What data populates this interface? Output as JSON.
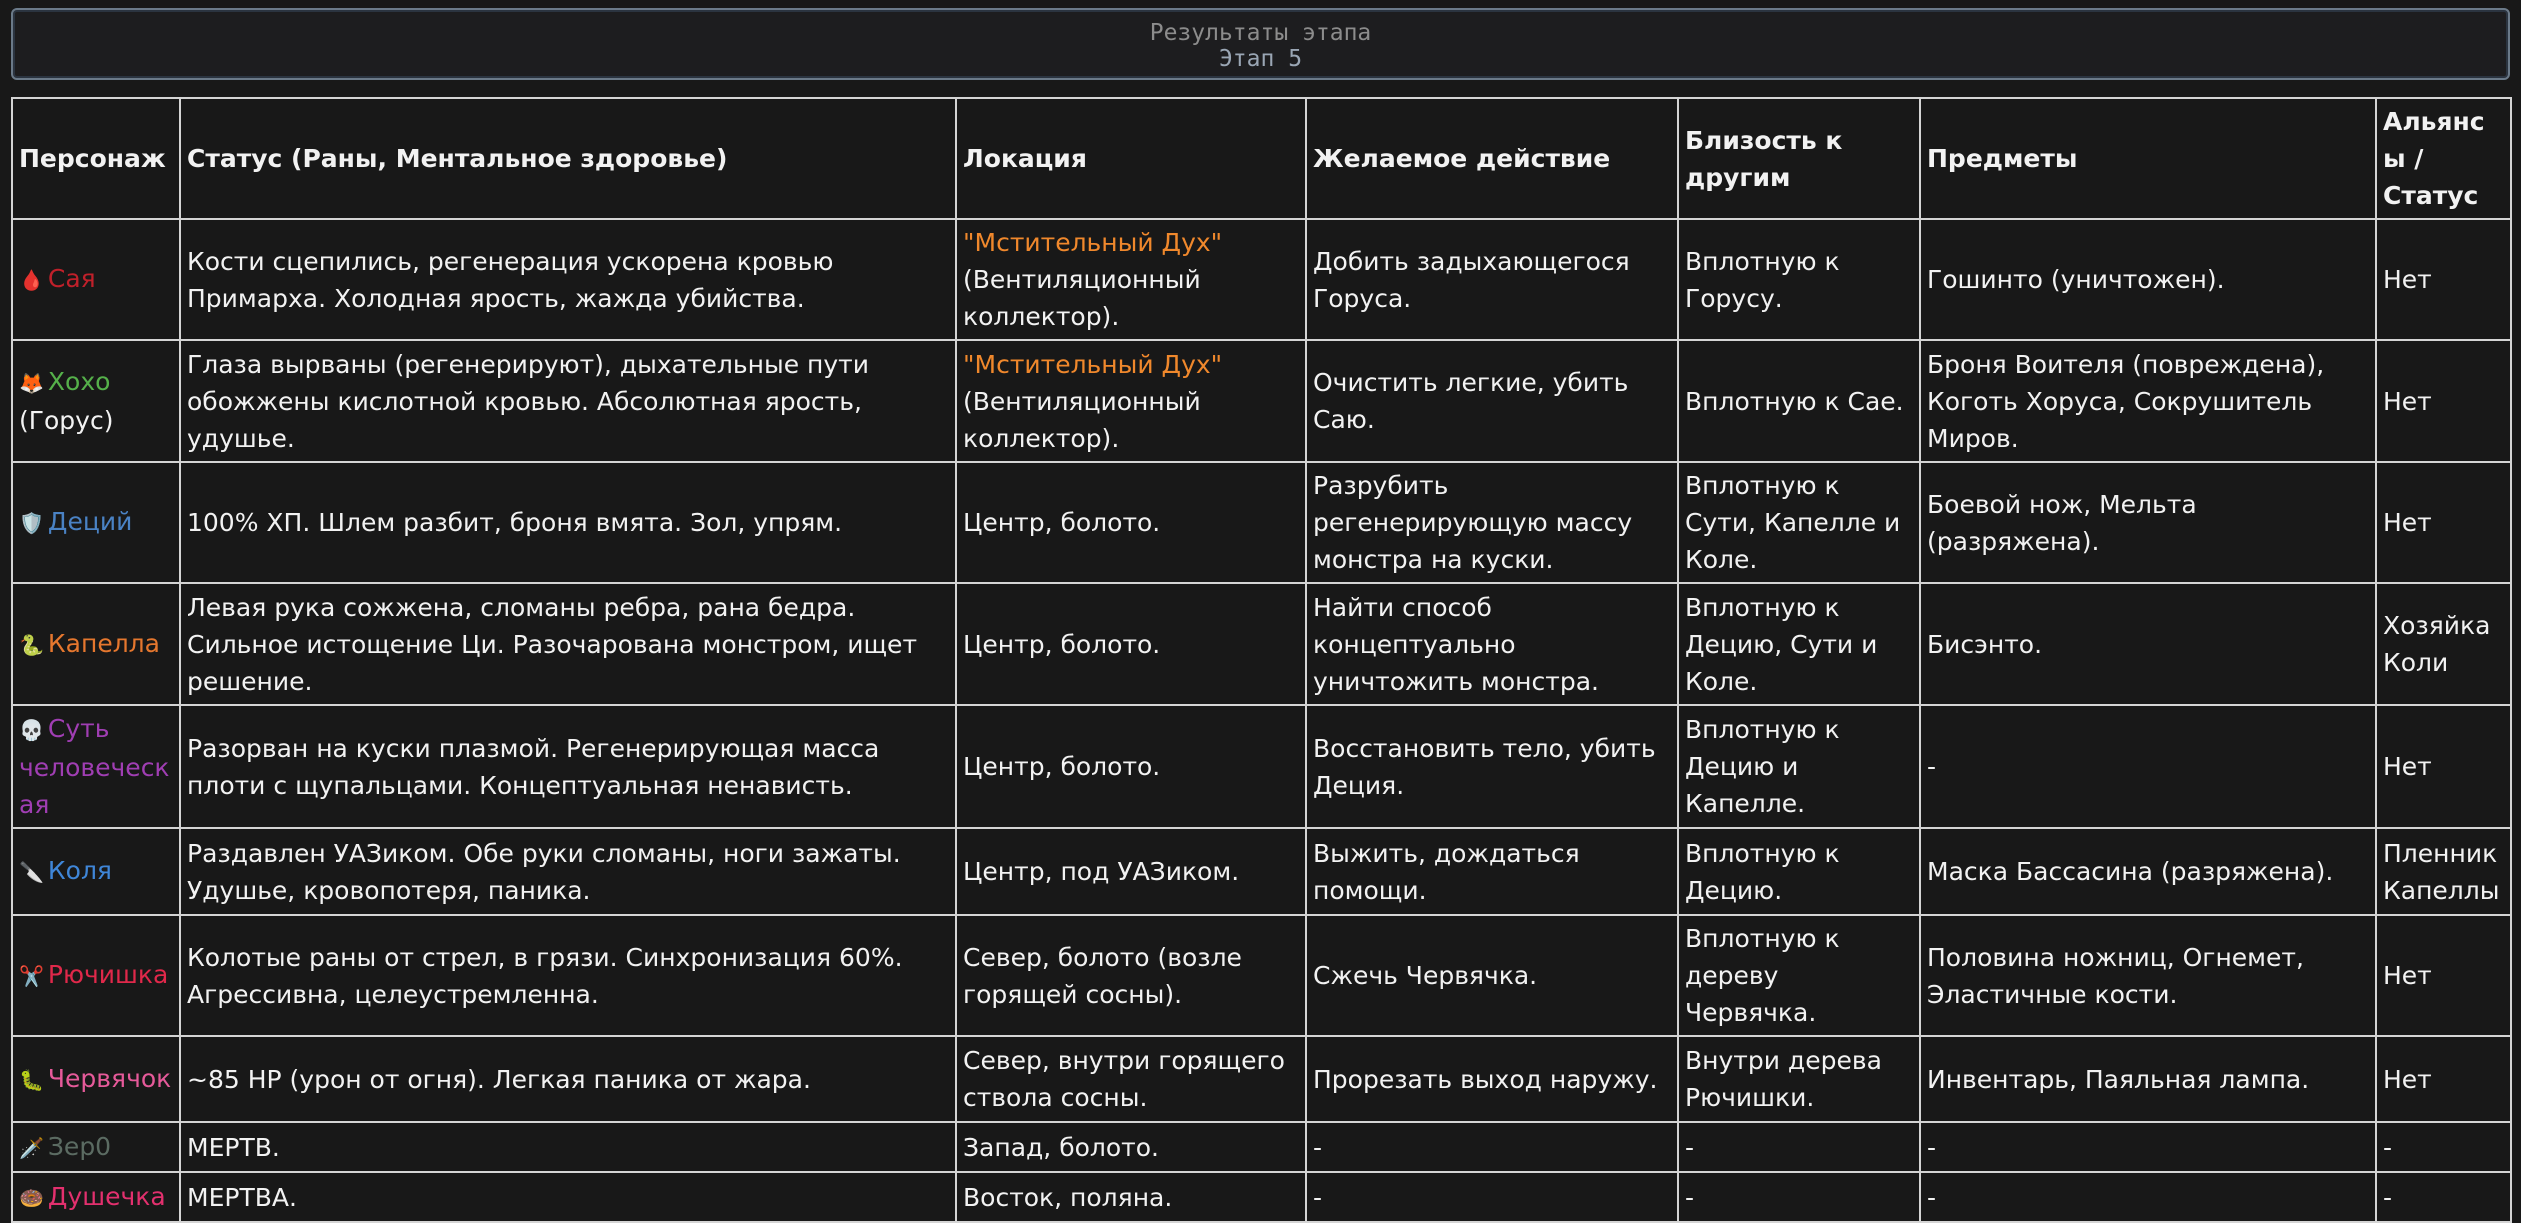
{
  "header": {
    "title": "Результаты этапа",
    "subtitle": "Этап 5"
  },
  "columns": [
    "Персонаж",
    "Статус (Раны, Ментальное здоровье)",
    "Локация",
    "Желаемое действие",
    "Близость к другим",
    "Предметы",
    "Альянсы / Статус"
  ],
  "rows": [
    {
      "icon": "🩸",
      "icon_name": "blood-drop-icon",
      "name": "Сая",
      "name_suffix": "",
      "color": "#c0202a",
      "status": "Кости сцепились, регенерация ускорена кровью Примарха. Холодная ярость, жажда убийства.",
      "location_accent": "\"Мстительный Дух\"",
      "location": "(Вентиляционный коллектор).",
      "action": "Добить задыхающегося Горуса.",
      "proximity": "Вплотную к Горусу.",
      "items": "Гошинто (уничтожен).",
      "alliance": "Нет"
    },
    {
      "icon": "🦊",
      "icon_name": "fox-icon",
      "name": "Хохо",
      "name_suffix": "(Горус)",
      "color": "#55b04a",
      "status": "Глаза вырваны (регенерируют), дыхательные пути обожжены кислотной кровью. Абсолютная ярость, удушье.",
      "location_accent": "\"Мстительный Дух\"",
      "location": "(Вентиляционный коллектор).",
      "action": "Очистить легкие, убить Саю.",
      "proximity": "Вплотную к Сае.",
      "items": "Броня Воителя (повреждена), Коготь Хоруса, Сокрушитель Миров.",
      "alliance": "Нет"
    },
    {
      "icon": "🛡️",
      "icon_name": "shield-icon",
      "name": "Деций",
      "name_suffix": "",
      "color": "#4a82c4",
      "status": "100% ХП. Шлем разбит, броня вмята. Зол, упрям.",
      "location_accent": "",
      "location": "Центр, болото.",
      "action": "Разрубить регенерирующую массу монстра на куски.",
      "proximity": "Вплотную к Сути, Капелле и Коле.",
      "items": "Боевой нож, Мельта (разряжена).",
      "alliance": "Нет"
    },
    {
      "icon": "🐍",
      "icon_name": "snake-icon",
      "name": "Капелла",
      "name_suffix": "",
      "color": "#e5772e",
      "status": "Левая рука сожжена, сломаны ребра, рана бедра. Сильное истощение Ци. Разочарована монстром, ищет решение.",
      "location_accent": "",
      "location": "Центр, болото.",
      "action": "Найти способ концептуально уничтожить монстра.",
      "proximity": "Вплотную к Децию, Сути и Коле.",
      "items": "Бисэнто.",
      "alliance": "Хозяйка Коли"
    },
    {
      "icon": "💀",
      "icon_name": "skull-icon",
      "name": "Суть человеческая",
      "name_suffix": "",
      "color": "#a03eb3",
      "status": "Разорван на куски плазмой. Регенерирующая масса плоти с щупальцами. Концептуальная ненависть.",
      "location_accent": "",
      "location": "Центр, болото.",
      "action": "Восстановить тело, убить Деция.",
      "proximity": "Вплотную к Децию и Капелле.",
      "items": "-",
      "alliance": "Нет"
    },
    {
      "icon": "🔪",
      "icon_name": "knife-icon",
      "name": "Коля",
      "name_suffix": "",
      "color": "#3f86d8",
      "status": "Раздавлен УАЗиком. Обе руки сломаны, ноги зажаты. Удушье, кровопотеря, паника.",
      "location_accent": "",
      "location": "Центр, под УАЗиком.",
      "action": "Выжить, дождаться помощи.",
      "proximity": "Вплотную к Децию.",
      "items": "Маска Бассасина (разряжена).",
      "alliance": "Пленник Капеллы"
    },
    {
      "icon": "✂️",
      "icon_name": "scissors-icon",
      "name": "Рючишка",
      "name_suffix": "",
      "color": "#e0284a",
      "status": "Колотые раны от стрел, в грязи. Синхронизация 60%. Агрессивна, целеустремленна.",
      "location_accent": "",
      "location": "Север, болото (возле горящей сосны).",
      "action": "Сжечь Червячка.",
      "proximity": "Вплотную к дереву Червячка.",
      "items": "Половина ножниц, Огнемет, Эластичные кости.",
      "alliance": "Нет"
    },
    {
      "icon": "🐛",
      "icon_name": "worm-icon",
      "name": "Червячок",
      "name_suffix": "",
      "color": "#e65a9a",
      "status": "~85 HP (урон от огня). Легкая паника от жара.",
      "location_accent": "",
      "location": "Север, внутри горящего ствола сосны.",
      "action": "Прорезать выход наружу.",
      "proximity": "Внутри дерева Рючишки.",
      "items": "Инвентарь, Паяльная лампа.",
      "alliance": "Нет"
    },
    {
      "icon": "🗡️",
      "icon_name": "dagger-icon",
      "name": "Зер0",
      "name_suffix": "",
      "color": "#5b6b62",
      "status": "МЕРТВ.",
      "location_accent": "",
      "location": "Запад, болото.",
      "action": "-",
      "proximity": "-",
      "items": "-",
      "alliance": "-"
    },
    {
      "icon": "🍩",
      "icon_name": "donut-icon",
      "name": "Душечка",
      "name_suffix": "",
      "color": "#e3306e",
      "status": "МЕРТВА.",
      "location_accent": "",
      "location": "Восток, поляна.",
      "action": "-",
      "proximity": "-",
      "items": "-",
      "alliance": "-"
    }
  ]
}
